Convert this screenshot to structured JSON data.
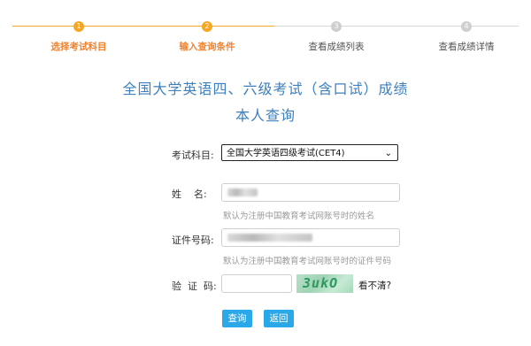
{
  "steps": [
    {
      "number": "1",
      "label": "选择考试科目",
      "state": "done"
    },
    {
      "number": "2",
      "label": "输入查询条件",
      "state": "current"
    },
    {
      "number": "3",
      "label": "查看成绩列表",
      "state": "todo"
    },
    {
      "number": "4",
      "label": "查看成绩详情",
      "state": "todo"
    }
  ],
  "title": {
    "line1": "全国大学英语四、六级考试（含口试）成绩",
    "line2": "本人查询"
  },
  "form": {
    "subject_label": "考试科目:",
    "subject_value": "全国大学英语四级考试(CET4)",
    "name_label": "姓    名:",
    "name_hint": "默认为注册中国教育考试网账号时的姓名",
    "id_label": "证件号码:",
    "id_hint": "默认为注册中国教育考试网账号时的证件号码",
    "captcha_label": "验  证  码:",
    "captcha_text": "3ukO",
    "captcha_refresh": "看不清?"
  },
  "buttons": {
    "query": "查询",
    "back": "返回"
  },
  "colors": {
    "accent_orange": "#f5a623",
    "title_blue": "#3d7fbf",
    "button_blue": "#2aa8e8"
  }
}
